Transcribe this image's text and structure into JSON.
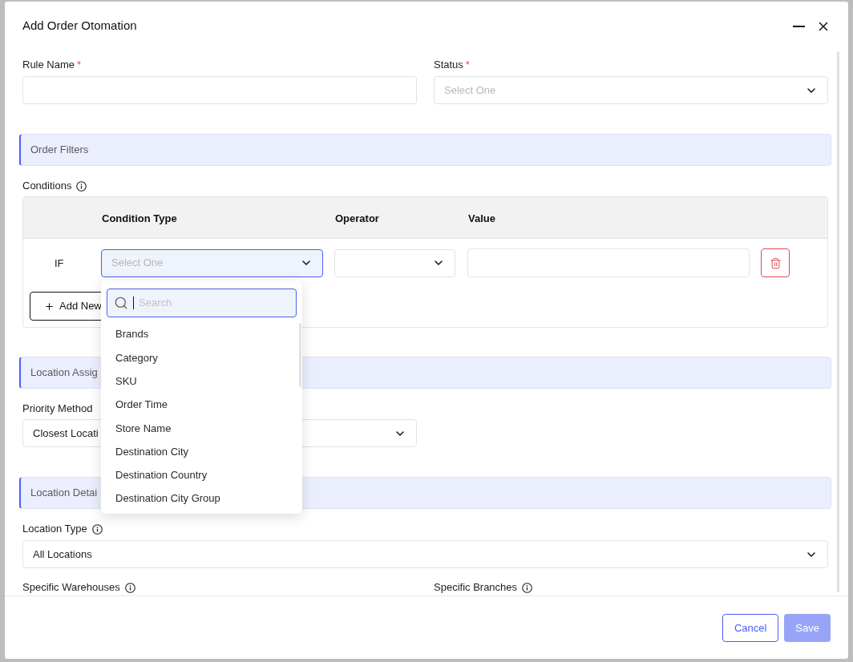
{
  "window": {
    "title": "Add Order Otomation"
  },
  "top_fields": [
    {
      "kind": "text",
      "label": "Rule Name",
      "required_mark": "*"
    },
    {
      "kind": "select",
      "label": "Status",
      "required_mark": "*",
      "placeholder": "Select One"
    }
  ],
  "order_filters": {
    "title": "Order Filters",
    "conditions": {
      "label": "Conditions",
      "columns": [
        "Condition Type",
        "Operator",
        "Value"
      ],
      "rows": [
        {
          "prefix": "IF",
          "condition_type": {
            "placeholder": "Select One",
            "expanded": true
          }
        }
      ],
      "add_button": "Add New"
    }
  },
  "condition_dropdown": {
    "search": {
      "placeholder": "Search",
      "focused": true
    },
    "options": [
      "Brands",
      "Category",
      "SKU",
      "Order Time",
      "Store Name",
      "Destination City",
      "Destination Country",
      "Destination City Group"
    ]
  },
  "location_assignment": {
    "title": "Location Assig",
    "priority_method": {
      "label": "Priority Method",
      "value": "Closest Locati"
    }
  },
  "location_details": {
    "title": "Location Detai",
    "location_type": {
      "label": "Location Type",
      "value": "All Locations"
    },
    "specific_fields": [
      {
        "label": "Specific Warehouses"
      },
      {
        "label": "Specific Branches"
      }
    ]
  },
  "footer": {
    "buttons": [
      {
        "label": "Cancel",
        "kind": "outline",
        "disabled": false
      },
      {
        "label": "Save",
        "kind": "primary",
        "disabled": true
      }
    ]
  }
}
